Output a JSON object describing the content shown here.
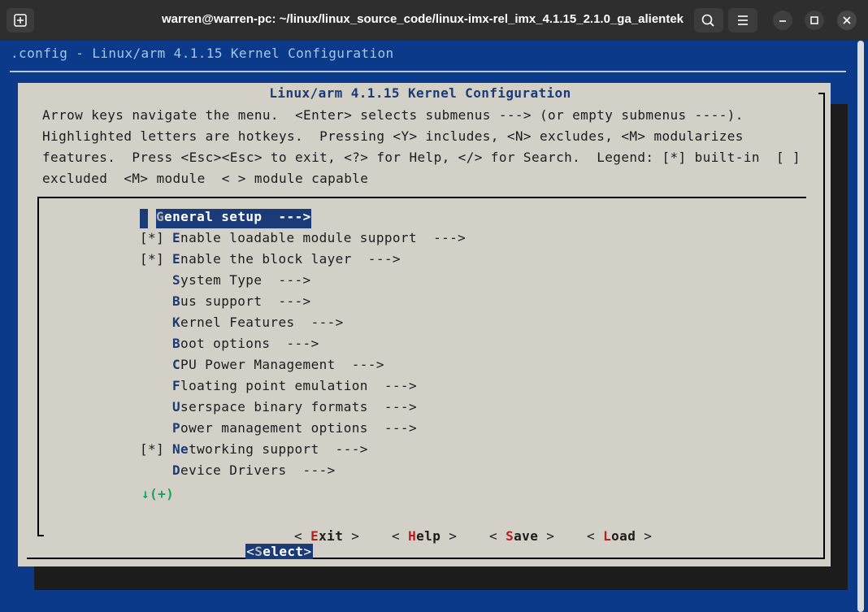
{
  "window": {
    "title": "warren@warren-pc: ~/linux/linux_source_code/linux-imx-rel_imx_4.1.15_2.1.0_ga_alientek"
  },
  "terminal": {
    "config_title": ".config - Linux/arm 4.1.15 Kernel Configuration",
    "dialog_title": "Linux/arm 4.1.15 Kernel Configuration",
    "help_lines": [
      "Arrow keys navigate the menu.  <Enter> selects submenus ---> (or empty submenus ----).",
      "Highlighted letters are hotkeys.  Pressing <Y> includes, <N> excludes, <M> modularizes",
      "features.  Press <Esc><Esc> to exit, <?> for Help, </> for Search.  Legend: [*] built-in  [ ]",
      "excluded  <M> module  < > module capable"
    ],
    "menu": [
      {
        "prefix": "",
        "hotkey": "G",
        "rest": "eneral setup  --->"
      },
      {
        "prefix": "[*]",
        "hotkey": "E",
        "rest": "nable loadable module support  --->"
      },
      {
        "prefix": "[*]",
        "hotkey": "E",
        "rest": "nable the block layer  --->"
      },
      {
        "prefix": "",
        "hotkey": "S",
        "rest": "ystem Type  --->"
      },
      {
        "prefix": "",
        "hotkey": "B",
        "rest": "us support  --->"
      },
      {
        "prefix": "",
        "hotkey": "K",
        "rest": "ernel Features  --->"
      },
      {
        "prefix": "",
        "hotkey": "B",
        "rest": "oot options  --->"
      },
      {
        "prefix": "",
        "hotkey": "C",
        "rest": "PU Power Management  --->"
      },
      {
        "prefix": "",
        "hotkey": "F",
        "rest": "loating point emulation  --->"
      },
      {
        "prefix": "",
        "hotkey": "U",
        "rest": "serspace binary formats  --->"
      },
      {
        "prefix": "",
        "hotkey": "P",
        "rest": "ower management options  --->"
      },
      {
        "prefix": "[*]",
        "hotkey": "Ne",
        "rest": "tworking support  --->"
      },
      {
        "prefix": "",
        "hotkey": "D",
        "rest": "evice Drivers  --->"
      }
    ],
    "more_indicator": "↓(+)",
    "buttons": {
      "select": {
        "left": "<",
        "hotkey": "S",
        "rest": "elect",
        "right": ">"
      },
      "exit": {
        "left": "< ",
        "hotkey": "E",
        "rest": "xit",
        "right": " >"
      },
      "help": {
        "left": "< ",
        "hotkey": "H",
        "rest": "elp",
        "right": " >"
      },
      "save": {
        "left": "< ",
        "hotkey": "S",
        "rest": "ave",
        "right": " >"
      },
      "load": {
        "left": "< ",
        "hotkey": "L",
        "rest": "oad",
        "right": " >"
      }
    }
  },
  "icons": {
    "new_tab": "new-tab-icon",
    "search": "search-icon",
    "menu": "hamburger-menu-icon",
    "minimize": "minimize-icon",
    "maximize": "maximize-icon",
    "close": "close-icon"
  },
  "colors": {
    "terminal_bg": "#0b3a8a",
    "dialog_bg": "#d3d0c8",
    "highlight": "#1a3b77",
    "hotkey_button": "#b42020",
    "more_indicator": "#19a25a"
  }
}
